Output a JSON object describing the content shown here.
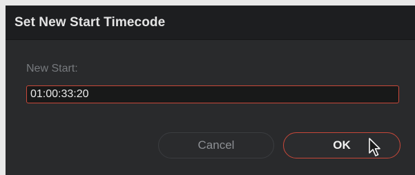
{
  "dialog": {
    "title": "Set New Start Timecode",
    "field_label": "New Start:",
    "field_value": "01:00:33:20",
    "cancel_label": "Cancel",
    "ok_label": "OK"
  },
  "colors": {
    "accent": "#c9483a",
    "dialog_bg": "#292a2c",
    "titlebar_bg": "#1d1e20",
    "field_bg": "#181919"
  },
  "icons": {
    "cursor": "mouse-pointer-icon"
  }
}
